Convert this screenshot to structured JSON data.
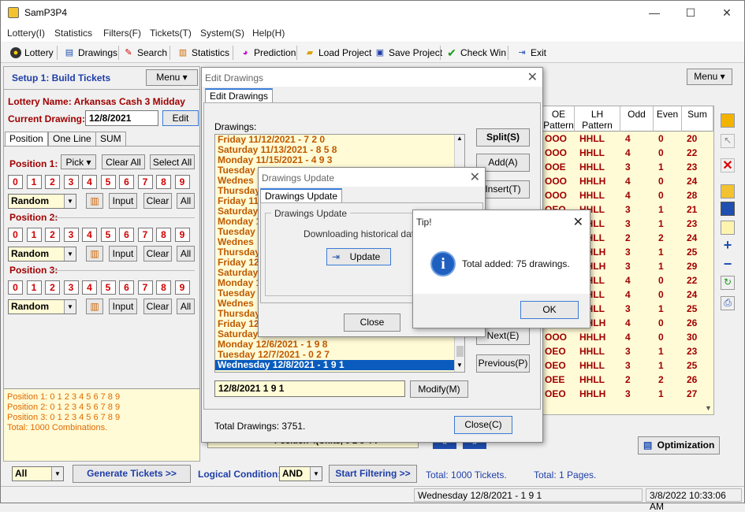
{
  "app": {
    "title": "SamP3P4"
  },
  "menu": [
    "Lottery(I)",
    "Statistics",
    "Filters(F)",
    "Tickets(T)",
    "System(S)",
    "Help(H)"
  ],
  "toolbar": {
    "lottery": "Lottery",
    "drawings": "Drawings",
    "search": "Search",
    "statistics": "Statistics",
    "prediction": "Prediction",
    "load": "Load Project",
    "save": "Save Project",
    "check": "Check Win",
    "exit": "Exit"
  },
  "left": {
    "setup": "Setup 1: Build  Tickets",
    "menu": "Menu",
    "lottery_name": "Lottery  Name: Arkansas Cash 3 Midday",
    "current_label": "Current Drawing:",
    "current_value": "12/8/2021",
    "edit": "Edit",
    "tabs": [
      "Position",
      "One Line",
      "SUM"
    ],
    "pos1": "Position 1:",
    "pos2": "Position 2:",
    "pos3": "Position 3:",
    "pick": "Pick",
    "clear_all": "Clear All",
    "select_all": "Select All",
    "digits": [
      "0",
      "1",
      "2",
      "3",
      "4",
      "5",
      "6",
      "7",
      "8",
      "9"
    ],
    "random": "Random",
    "input": "Input",
    "clear": "Clear",
    "all": "All",
    "summary": [
      "Position 1:  0 1 2 3 4 5 6 7 8 9",
      "Position 2:  0 1 2 3 4 5 6 7 8 9",
      "Position 3:  0 1 2 3 4 5 6 7 8 9",
      "Total: 1000 Combinations."
    ]
  },
  "right": {
    "menu": "Menu",
    "headers": [
      "OE Pattern",
      "LH Pattern",
      "Odd",
      "Even",
      "Sum"
    ],
    "rows": [
      [
        "OOO",
        "HHLL",
        "4",
        "0",
        "20"
      ],
      [
        "OOO",
        "HHLL",
        "4",
        "0",
        "22"
      ],
      [
        "OOE",
        "HHLL",
        "3",
        "1",
        "23"
      ],
      [
        "OOO",
        "HHLH",
        "4",
        "0",
        "24"
      ],
      [
        "OOO",
        "HHLL",
        "4",
        "0",
        "28"
      ],
      [
        "OEO",
        "HHLL",
        "3",
        "1",
        "21"
      ],
      [
        "OEO",
        "HHLL",
        "3",
        "1",
        "23"
      ],
      [
        "OEE",
        "HHLL",
        "2",
        "2",
        "24"
      ],
      [
        "OEO",
        "HHLH",
        "3",
        "1",
        "25"
      ],
      [
        "OEO",
        "HHLH",
        "3",
        "1",
        "29"
      ],
      [
        "OOO",
        "HHLL",
        "4",
        "0",
        "22"
      ],
      [
        "OOO",
        "HHLL",
        "4",
        "0",
        "24"
      ],
      [
        "OEO",
        "HHLL",
        "3",
        "1",
        "25"
      ],
      [
        "OOO",
        "HHLH",
        "4",
        "0",
        "26"
      ],
      [
        "OOO",
        "HHLH",
        "4",
        "0",
        "30"
      ],
      [
        "OEO",
        "HHLL",
        "3",
        "1",
        "23"
      ],
      [
        "OEO",
        "HHLL",
        "3",
        "1",
        "25"
      ],
      [
        "OEE",
        "HHLL",
        "2",
        "2",
        "26"
      ],
      [
        "OEO",
        "HHLH",
        "3",
        "1",
        "27"
      ]
    ],
    "optimization": "Optimization"
  },
  "bottom": {
    "all": "All",
    "generate": "Generate Tickets >>",
    "logic_label": "Logical Condition:",
    "logic_value": "AND",
    "start": "Start Filtering  >>",
    "total_tickets": "Total: 1000 Tickets.",
    "total_pages": "Total: 1 Pages.",
    "status_draw": "Wednesday 12/8/2021 - 1 9 1",
    "status_time": "3/8/2022 10:33:06 AM"
  },
  "edit_dlg": {
    "title": "Edit Drawings",
    "tab": "Edit Drawings",
    "drawings_label": "Drawings:",
    "items": [
      "Friday 11/12/2021 - 7 2 0",
      "Saturday 11/13/2021 - 8 5 8",
      "Monday 11/15/2021 - 4 9 3",
      "Tuesday",
      "Wednes",
      "Thursday",
      "Friday 11",
      "Saturday",
      "Monday 1",
      "Tuesday",
      "Wednes",
      "Thursday",
      "Friday 12",
      "Saturday",
      "Monday 1",
      "Tuesday",
      "Wednes",
      "Thursday",
      "Friday 12",
      "Saturday",
      "Monday 12/6/2021 - 1 9 8",
      "Tuesday 12/7/2021 - 0 2 7",
      "Wednesday 12/8/2021 - 1 9 1"
    ],
    "edit_value": "12/8/2021 1 9 1",
    "modify": "Modify(M)",
    "split": "Split(S)",
    "add": "Add(A)",
    "insert": "Insert(T)",
    "next": "Next(E)",
    "previous": "Previous(P)",
    "total": "Total Drawings: 3751.",
    "close": "Close(C)",
    "behind_text": "Position 4(Units, 0 2 3 4 7"
  },
  "update_dlg": {
    "title": "Drawings Update",
    "tab": "Drawings Update",
    "group": "Drawings Update",
    "text": "Downloading historical data, p",
    "update": "Update",
    "close": "Close"
  },
  "tip": {
    "title": "Tip!",
    "message": "Total added: 75 drawings.",
    "ok": "OK"
  }
}
